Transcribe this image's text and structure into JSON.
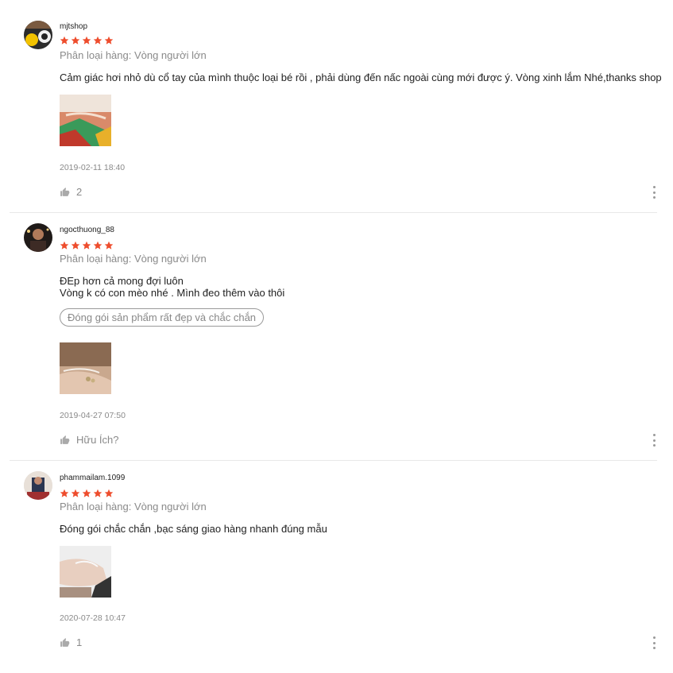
{
  "star_color": "#ee4d2d",
  "reviews": [
    {
      "username": "mjtshop",
      "rating": 5,
      "variation": "Phân loại hàng: Vòng người lớn",
      "comment_lines": [
        "Cảm giác hơi nhỏ dù cổ tay của mình thuộc loại bé rồi , phải dùng đến nấc ngoài cùng mới được ý. Vòng xinh lắm Nhé,thanks shop"
      ],
      "timestamp": "2019-02-11 18:40",
      "likes": "2",
      "icon": "thumbs-up-icon"
    },
    {
      "username": "ngocthuong_88",
      "rating": 5,
      "variation": "Phân loại hàng: Vòng người lớn",
      "comment_lines": [
        "ĐEp hơn cả mong đợi luôn",
        "Vòng k có con mèo nhé . Mình đeo thêm vào thôi"
      ],
      "tag": "Đóng gói sản phẩm rất đẹp và chắc chắn",
      "timestamp": "2019-04-27 07:50",
      "likes": "Hữu Ích?",
      "icon": "thumbs-up-icon"
    },
    {
      "username": "phammailam.1099",
      "rating": 5,
      "variation": "Phân loại hàng: Vòng người lớn",
      "comment_lines": [
        "Đóng gói chắc chắn ,bạc sáng giao hàng nhanh đúng mẫu"
      ],
      "timestamp": "2020-07-28 10:47",
      "likes": "1",
      "icon": "thumbs-up-icon"
    }
  ]
}
